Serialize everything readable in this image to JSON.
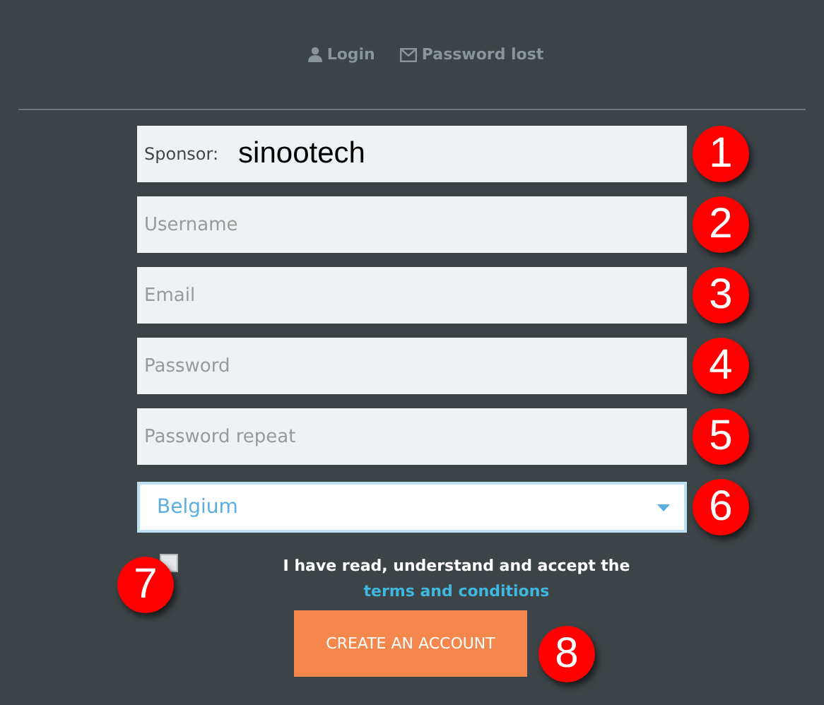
{
  "nav": [
    {
      "kind": "user",
      "label": "Login"
    },
    {
      "kind": "envelope",
      "label": "Password lost"
    }
  ],
  "fields": [
    {
      "kind": "sponsor",
      "label": "Sponsor:",
      "value": "sinootech",
      "marker": "1"
    },
    {
      "kind": "text",
      "placeholder": "Username",
      "marker": "2"
    },
    {
      "kind": "text",
      "placeholder": "Email",
      "marker": "3"
    },
    {
      "kind": "text",
      "placeholder": "Password",
      "marker": "4"
    },
    {
      "kind": "text",
      "placeholder": "Password repeat",
      "marker": "5"
    },
    {
      "kind": "select",
      "value": "Belgium",
      "marker": "6"
    }
  ],
  "terms": {
    "checked": false,
    "text": "I have read, understand and accept the",
    "link": "terms and conditions",
    "marker": "7"
  },
  "submit": {
    "label": "CREATE AN ACCOUNT",
    "marker": "8"
  }
}
